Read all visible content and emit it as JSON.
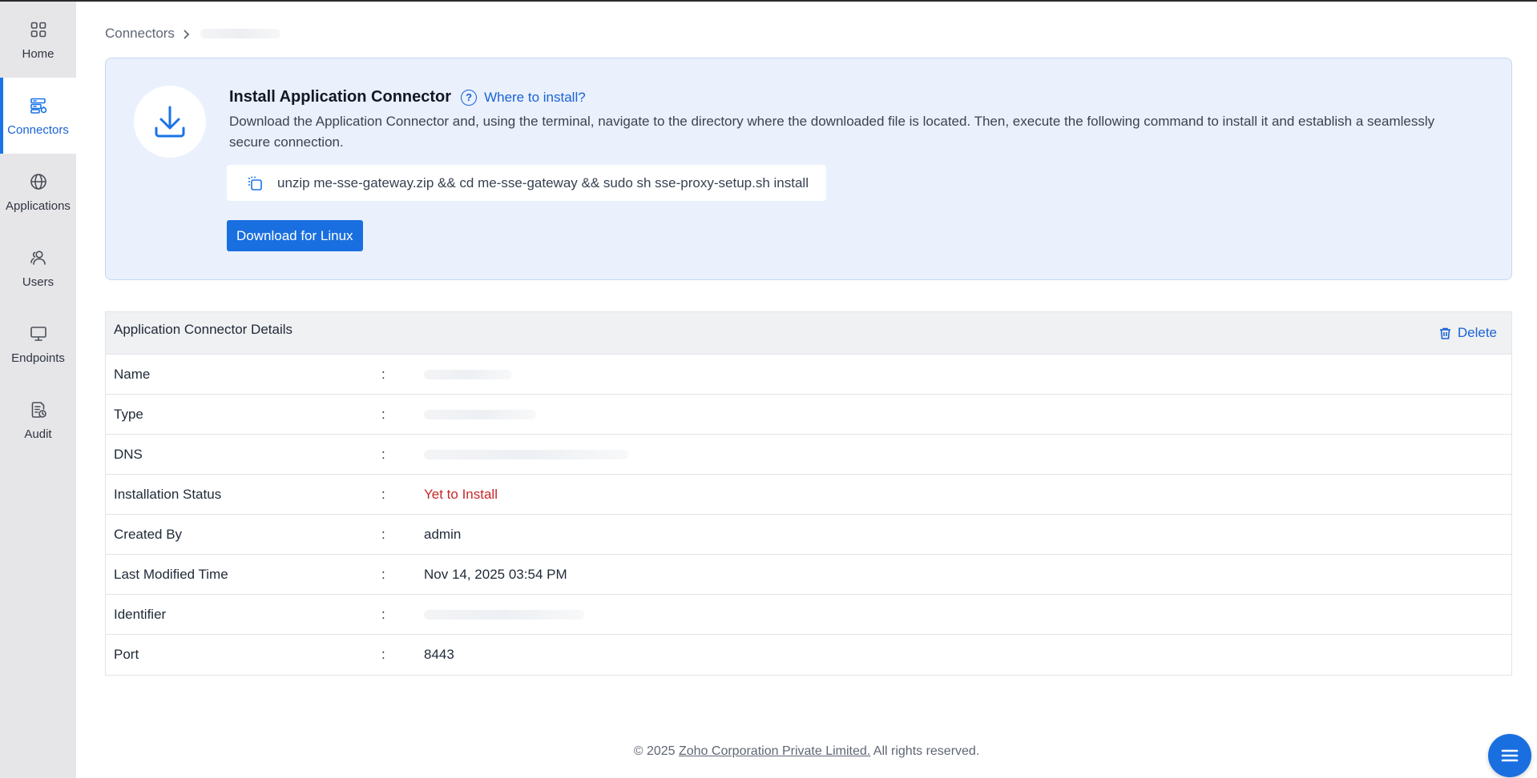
{
  "sidebar": {
    "items": [
      {
        "label": "Home",
        "icon": "grid-icon",
        "active": false
      },
      {
        "label": "Connectors",
        "icon": "connector-icon",
        "active": true
      },
      {
        "label": "Applications",
        "icon": "globe-icon",
        "active": false
      },
      {
        "label": "Users",
        "icon": "users-icon",
        "active": false
      },
      {
        "label": "Endpoints",
        "icon": "monitor-icon",
        "active": false
      },
      {
        "label": "Audit",
        "icon": "audit-icon",
        "active": false
      }
    ]
  },
  "breadcrumb": {
    "root": "Connectors"
  },
  "install": {
    "title": "Install Application Connector",
    "help_link": "Where to install?",
    "description": "Download the Application Connector and, using the terminal, navigate to the directory where the downloaded file is located. Then, execute the following command to install it and establish a seamlessly secure connection.",
    "command": "unzip me-sse-gateway.zip && cd me-sse-gateway && sudo sh sse-proxy-setup.sh install",
    "download_button": "Download for Linux"
  },
  "details": {
    "title": "Application Connector Details",
    "delete_label": "Delete",
    "separator": ":",
    "rows": [
      {
        "key": "Name",
        "value": ""
      },
      {
        "key": "Type",
        "value": ""
      },
      {
        "key": "DNS",
        "value": ""
      },
      {
        "key": "Installation Status",
        "value": "Yet to Install"
      },
      {
        "key": "Created By",
        "value": "admin"
      },
      {
        "key": "Last Modified Time",
        "value": "Nov 14, 2025 03:54 PM"
      },
      {
        "key": "Identifier",
        "value": ""
      },
      {
        "key": "Port",
        "value": "8443"
      }
    ]
  },
  "footer": {
    "prefix": "© 2025 ",
    "company": "Zoho Corporation Private Limited.",
    "suffix": " All rights reserved."
  },
  "colors": {
    "accent": "#1a6fe0",
    "status_pending": "#c62828",
    "sidebar_bg": "#e6e6e9",
    "card_bg": "#eaf1fc"
  }
}
